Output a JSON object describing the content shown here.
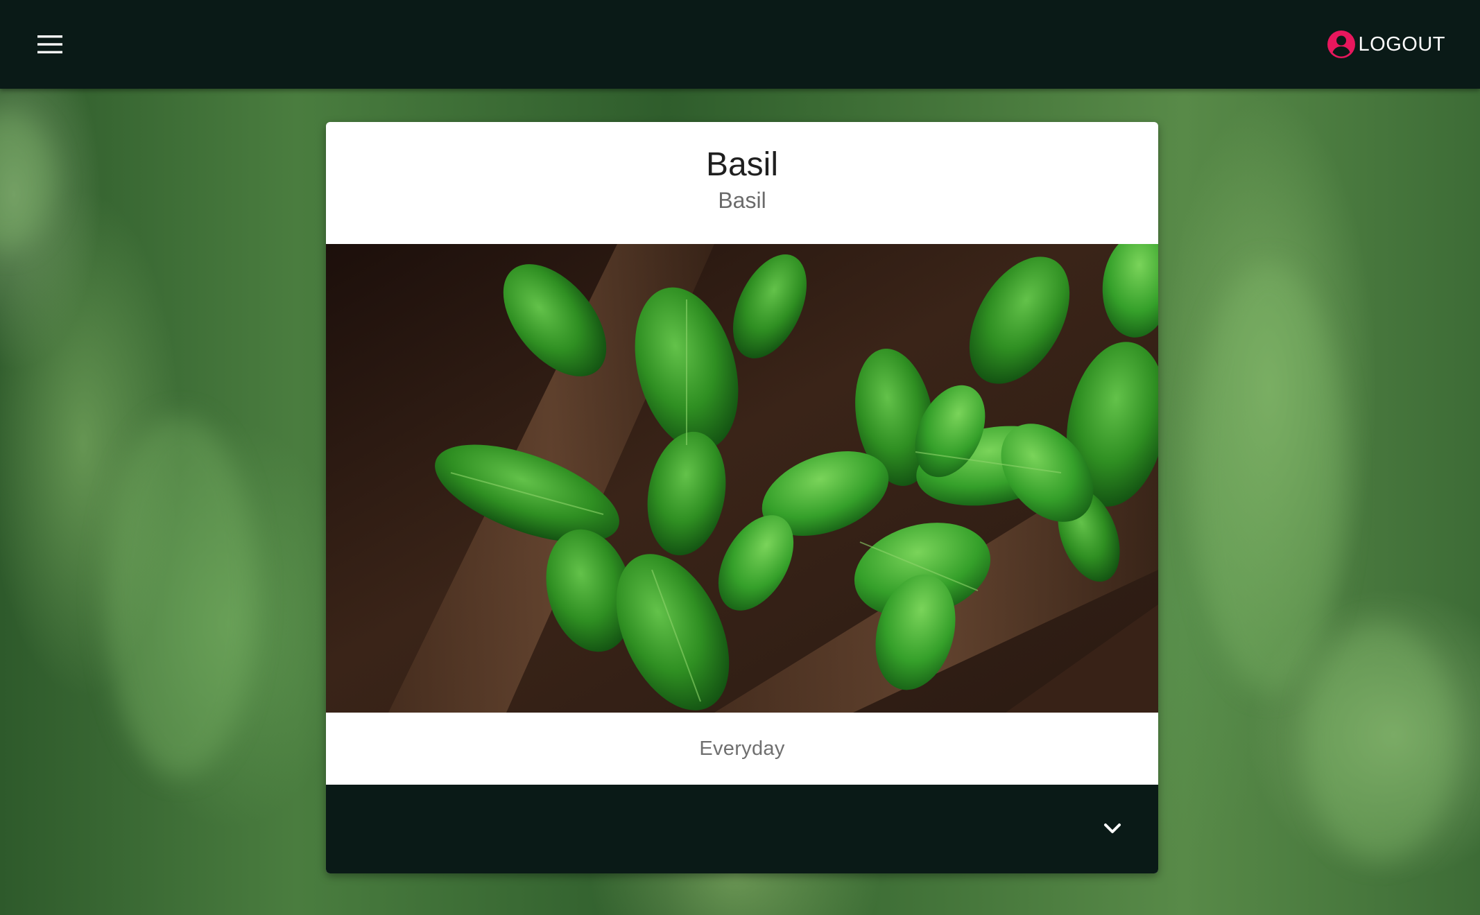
{
  "appbar": {
    "menu_icon": "hamburger-menu-icon",
    "account_icon": "account-circle-icon",
    "logout_label": "LOGOUT"
  },
  "card": {
    "title": "Basil",
    "subtitle": "Basil",
    "image_alt": "Basil",
    "description": "Everyday",
    "expand_icon": "chevron-down-icon"
  },
  "colors": {
    "appbar_bg": "#0a1a17",
    "account_icon": "#e8175d",
    "card_bg": "#ffffff",
    "title_text": "#1f1f1f",
    "secondary_text": "#6b6b6b"
  }
}
